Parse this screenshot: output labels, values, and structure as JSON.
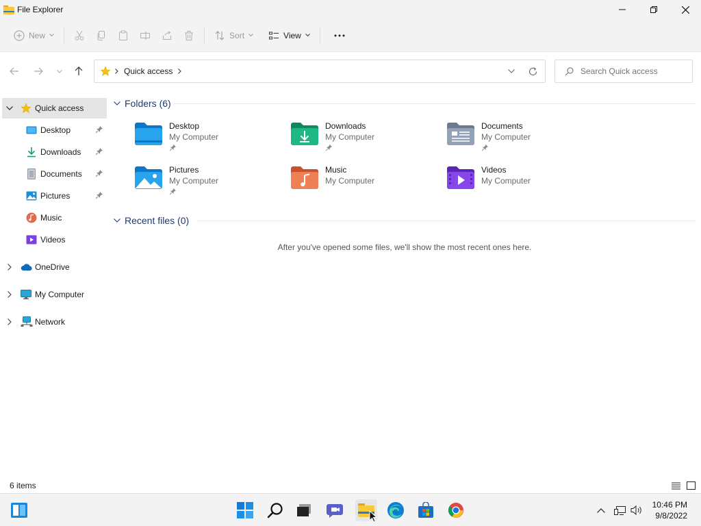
{
  "window": {
    "title": "File Explorer",
    "controls": [
      "minimize-icon",
      "restore-icon",
      "close-icon"
    ]
  },
  "commandbar": {
    "new_label": "New",
    "sort_label": "Sort",
    "view_label": "View",
    "icons": [
      "new-icon",
      "cut-icon",
      "copy-icon",
      "paste-icon",
      "rename-icon",
      "share-icon",
      "delete-icon",
      "sort-icon",
      "view-icon",
      "more-icon"
    ]
  },
  "address": {
    "location": "Quick access",
    "search_placeholder": "Search Quick access"
  },
  "sidebar": {
    "items": [
      {
        "label": "Quick access",
        "icon": "star-icon"
      },
      {
        "label": "Desktop",
        "icon": "desktop-folder-icon",
        "pinned": true
      },
      {
        "label": "Downloads",
        "icon": "downloads-icon",
        "pinned": true
      },
      {
        "label": "Documents",
        "icon": "documents-icon",
        "pinned": true
      },
      {
        "label": "Pictures",
        "icon": "pictures-icon",
        "pinned": true
      },
      {
        "label": "Music",
        "icon": "music-icon"
      },
      {
        "label": "Videos",
        "icon": "videos-icon"
      },
      {
        "label": "OneDrive",
        "icon": "onedrive-icon"
      },
      {
        "label": "My Computer",
        "icon": "computer-icon"
      },
      {
        "label": "Network",
        "icon": "network-icon"
      }
    ]
  },
  "main": {
    "folders_header": "Folders (6)",
    "folders": [
      {
        "name": "Desktop",
        "location": "My Computer",
        "pinned": true,
        "icon": "desktop-folder-icon"
      },
      {
        "name": "Downloads",
        "location": "My Computer",
        "pinned": true,
        "icon": "downloads-folder-icon"
      },
      {
        "name": "Documents",
        "location": "My Computer",
        "pinned": true,
        "icon": "documents-folder-icon"
      },
      {
        "name": "Pictures",
        "location": "My Computer",
        "pinned": true,
        "icon": "pictures-folder-icon"
      },
      {
        "name": "Music",
        "location": "My Computer",
        "pinned": false,
        "icon": "music-folder-icon"
      },
      {
        "name": "Videos",
        "location": "My Computer",
        "pinned": false,
        "icon": "videos-folder-icon"
      }
    ],
    "recent_header": "Recent files (0)",
    "recent_empty": "After you've opened some files, we'll show the most recent ones here."
  },
  "status": {
    "item_count": "6 items"
  },
  "taskbar": {
    "apps": [
      "widgets-icon",
      "start-icon",
      "search-icon",
      "task-view-icon",
      "chat-icon",
      "file-explorer-icon",
      "edge-icon",
      "store-icon",
      "chrome-icon"
    ],
    "tray": [
      "chevron-up-icon",
      "network-tray-icon",
      "volume-icon"
    ],
    "time": "10:46 PM",
    "date": "9/8/2022"
  },
  "colors": {
    "accent": "#0067c0",
    "header_text": "#1e3a6e",
    "chrome_bg": "#f3f3f3",
    "selected_bg": "#e5e5e5"
  }
}
